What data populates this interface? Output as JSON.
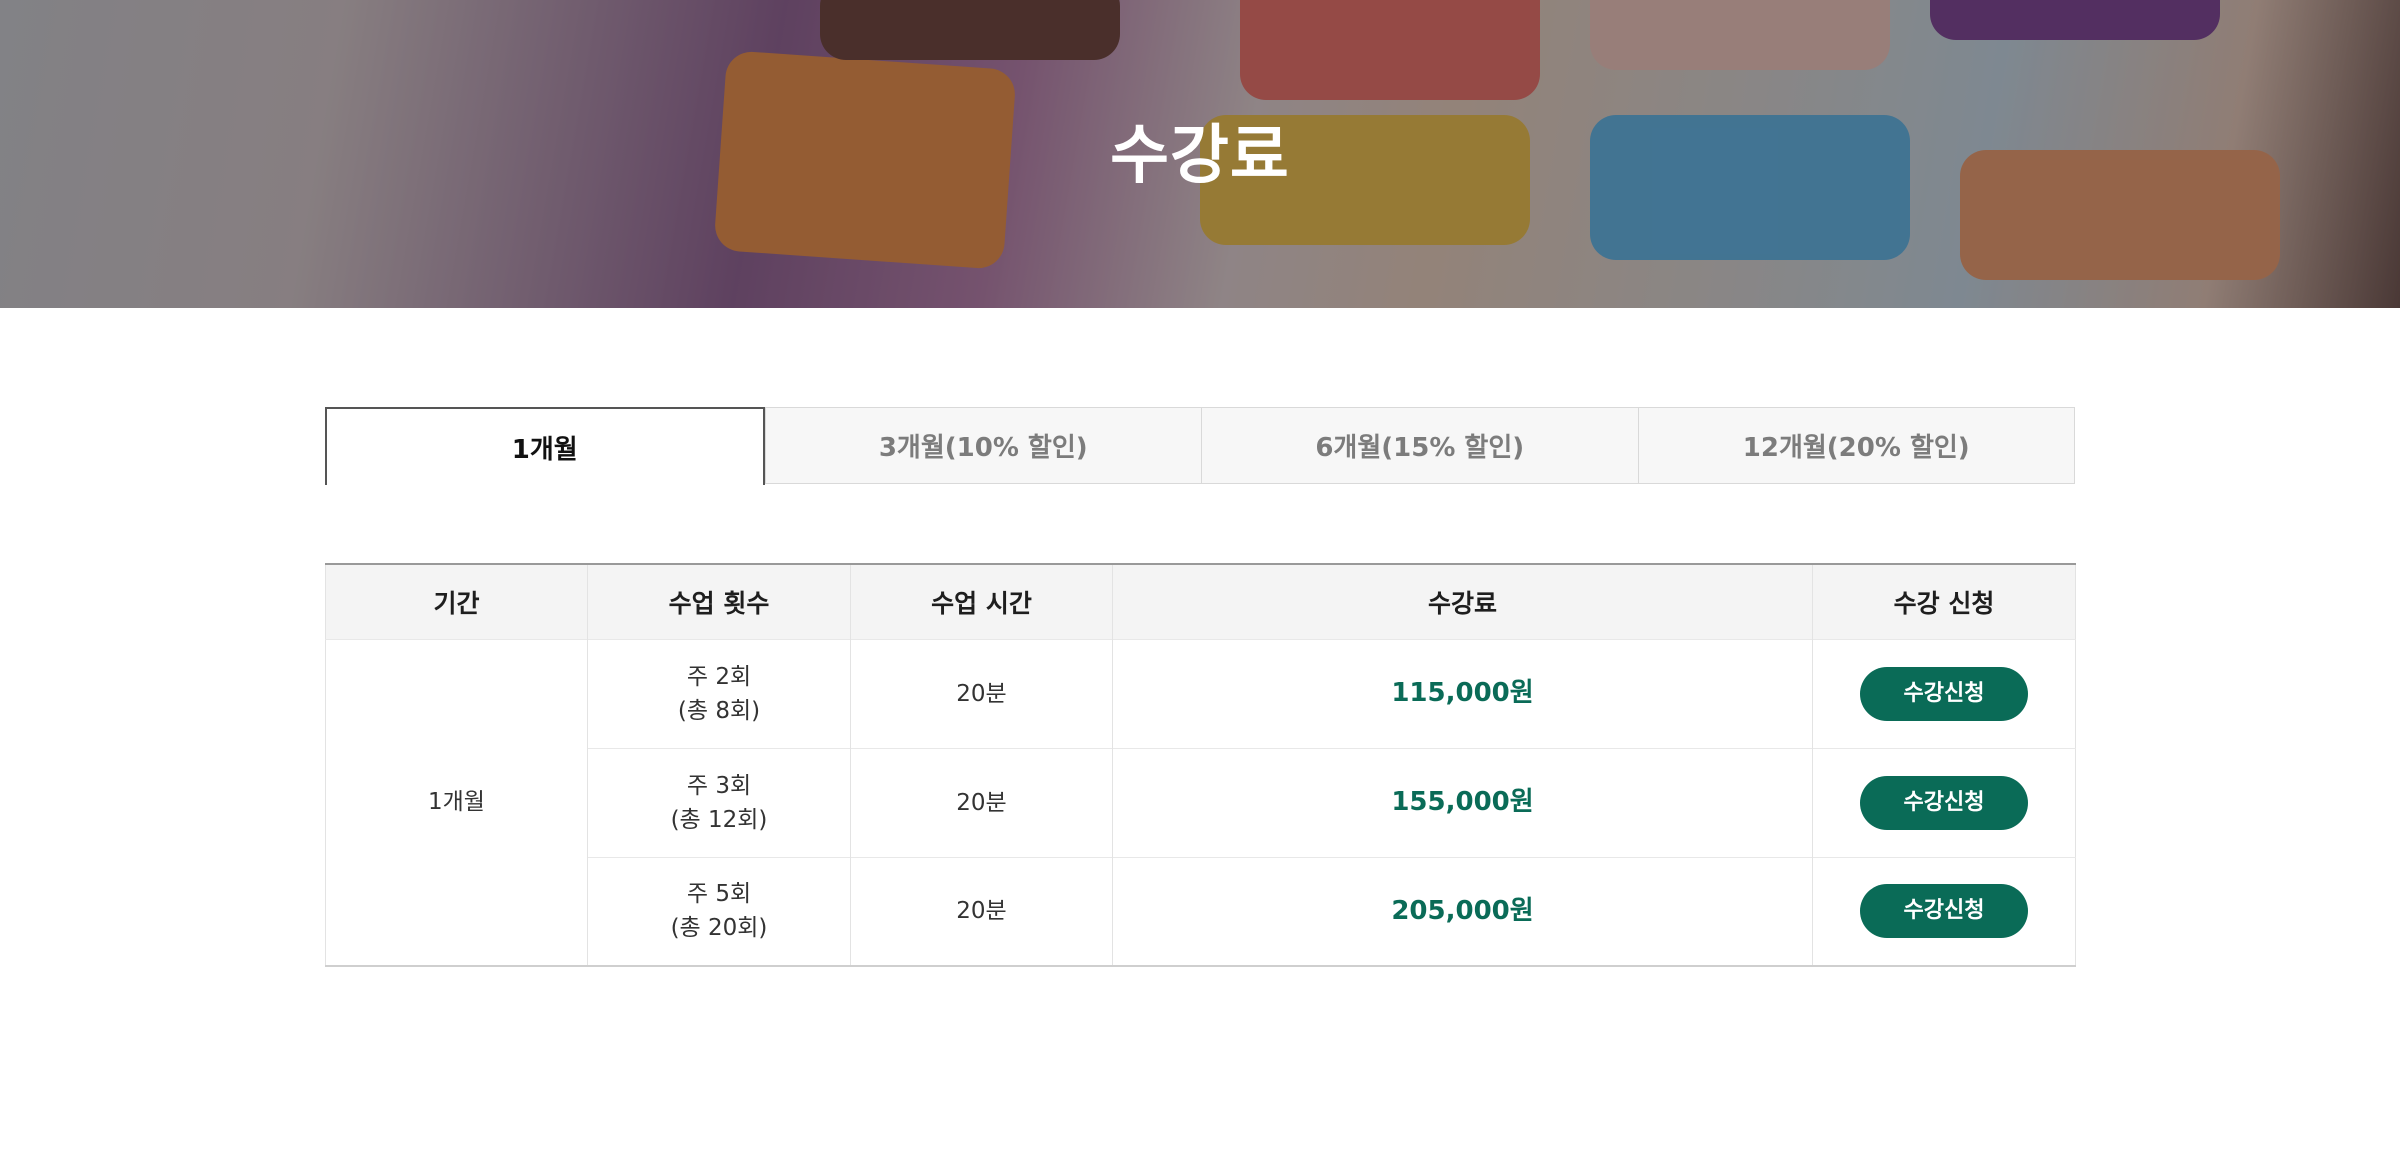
{
  "hero": {
    "title": "수강료"
  },
  "tabs": [
    {
      "label": "1개월",
      "active": true
    },
    {
      "label": "3개월(10% 할인)",
      "active": false
    },
    {
      "label": "6개월(15% 할인)",
      "active": false
    },
    {
      "label": "12개월(20% 할인)",
      "active": false
    }
  ],
  "table": {
    "headers": [
      "기간",
      "수업 횟수",
      "수업 시간",
      "수강료",
      "수강 신청"
    ],
    "period": "1개월",
    "rows": [
      {
        "count_line1": "주 2회",
        "count_line2": "(총 8회)",
        "time": "20분",
        "price": "115,000원",
        "button": "수강신청"
      },
      {
        "count_line1": "주 3회",
        "count_line2": "(총 12회)",
        "time": "20분",
        "price": "155,000원",
        "button": "수강신청"
      },
      {
        "count_line1": "주 5회",
        "count_line2": "(총 20회)",
        "time": "20분",
        "price": "205,000원",
        "button": "수강신청"
      }
    ]
  },
  "colors": {
    "accent": "#0a6b57",
    "header_bg": "#f4f4f4",
    "tab_bg": "#f7f7f7"
  }
}
